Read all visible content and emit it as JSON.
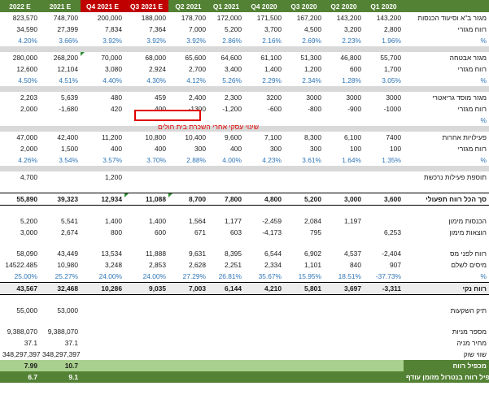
{
  "headers": [
    "2022 E",
    "2021 E",
    "Q4 2021 E",
    "Q3 2021 E",
    "Q2 2021",
    "Q1 2021",
    "Q4 2020",
    "Q3 2020",
    "Q2 2020",
    "Q1 2020",
    ""
  ],
  "rows": {
    "r1": [
      "823,570",
      "748,700",
      "200,000",
      "188,000",
      "178,700",
      "172,000",
      "171,500",
      "167,200",
      "143,200",
      "143,200",
      "מגזר ב\"א וסיעוד הכנסות"
    ],
    "r2": [
      "34,590",
      "27,399",
      "7,834",
      "7,364",
      "7,000",
      "5,200",
      "3,700",
      "4,500",
      "3,200",
      "2,800",
      "רווח מגזרי"
    ],
    "r3": [
      "4.20%",
      "3.66%",
      "3.92%",
      "3.92%",
      "3.92%",
      "2.86%",
      "2.16%",
      "2.69%",
      "2.23%",
      "1.96%",
      "%"
    ],
    "r4": [
      "280,000",
      "268,200",
      "70,000",
      "68,000",
      "65,600",
      "64,600",
      "61,100",
      "51,300",
      "46,800",
      "55,700",
      "מגזר אבטחה"
    ],
    "r5": [
      "12,600",
      "12,104",
      "3,080",
      "2,924",
      "2,700",
      "3,400",
      "1,400",
      "1,200",
      "600",
      "1,700",
      "רווח מגזרי"
    ],
    "r6": [
      "4.50%",
      "4.51%",
      "4.40%",
      "4.30%",
      "4.12%",
      "5.26%",
      "2.29%",
      "2.34%",
      "1.28%",
      "3.05%",
      "%"
    ],
    "r7": [
      "2,203",
      "5,639",
      "480",
      "459",
      "2,400",
      "2,300",
      "3200",
      "3000",
      "3000",
      "3000",
      "מגזר מוסד גריאטרי"
    ],
    "r8": [
      "2,000",
      "-1,680",
      "420",
      "400",
      "-1300",
      "-1,200",
      "-600",
      "-800",
      "-900",
      "-1000",
      "רווח מגזרי"
    ],
    "r9": [
      "",
      "",
      "",
      "",
      "",
      "",
      "",
      "",
      "",
      "",
      "%"
    ],
    "r10": [
      "47,000",
      "42,400",
      "11,200",
      "10,800",
      "10,400",
      "9,600",
      "7,100",
      "8,300",
      "6,100",
      "7400",
      "פעילויות אחרות"
    ],
    "r11": [
      "2,000",
      "1,500",
      "400",
      "400",
      "300",
      "400",
      "300",
      "300",
      "100",
      "100",
      "רווח מגזרי"
    ],
    "r12": [
      "4.26%",
      "3.54%",
      "3.57%",
      "3.70%",
      "2.88%",
      "4.00%",
      "4.23%",
      "3.61%",
      "1.64%",
      "1.35%",
      "%"
    ],
    "r13": [
      "4,700",
      "",
      "1,200",
      "",
      "",
      "",
      "",
      "",
      "",
      "",
      "תוספת פעילות נרכשת"
    ],
    "r14": [
      "55,890",
      "39,323",
      "12,934",
      "11,088",
      "8,700",
      "7,800",
      "4,800",
      "5,200",
      "3,000",
      "3,600",
      "סך הכל רווח תפעולי"
    ],
    "r15": [
      "5,200",
      "5,541",
      "1,400",
      "1,400",
      "1,564",
      "1,177",
      "-2,459",
      "2,084",
      "1,197",
      "",
      "הכנסות מימון"
    ],
    "r16": [
      "3,000",
      "2,674",
      "800",
      "600",
      "671",
      "603",
      "-4,173",
      "795",
      "",
      "6,253",
      "הוצאות מימון"
    ],
    "r17": [
      "58,090",
      "43,449",
      "13,534",
      "11,888",
      "9,631",
      "8,395",
      "6,544",
      "6,902",
      "4,537",
      "-2,404",
      "רווח לפני מס"
    ],
    "r18": [
      "14522.485",
      "10,980",
      "3,248",
      "2,853",
      "2,628",
      "2,251",
      "2,334",
      "1,101",
      "840",
      "907",
      "מיסים לשלם"
    ],
    "r19": [
      "25.00%",
      "25.27%",
      "24.00%",
      "24.00%",
      "27.29%",
      "26.81%",
      "35.67%",
      "15.95%",
      "18.51%",
      "-37.73%",
      "%"
    ],
    "r20": [
      "43,567",
      "32,468",
      "10,286",
      "9,035",
      "7,003",
      "6,144",
      "4,210",
      "5,801",
      "3,697",
      "-3,311",
      "רווח נקי"
    ],
    "r21": [
      "55,000",
      "53,000",
      "",
      "",
      "",
      "",
      "",
      "",
      "",
      "",
      "תיק השקעות"
    ],
    "r22": [
      "9,388,070",
      "9,388,070",
      "",
      "",
      "",
      "",
      "",
      "",
      "",
      "",
      "מספר מניות"
    ],
    "r23": [
      "37.1",
      "37.1",
      "",
      "",
      "",
      "",
      "",
      "",
      "",
      "",
      "מחיר מניה"
    ],
    "r24": [
      "348,297,397",
      "348,297,397",
      "",
      "",
      "",
      "",
      "",
      "",
      "",
      "",
      "שווי שוק"
    ],
    "r25": [
      "7.99",
      "10.7",
      "",
      "",
      "",
      "",
      "",
      "",
      "",
      "",
      "מכפיל רווח"
    ],
    "r26": [
      "6.7",
      "9.1",
      "",
      "",
      "",
      "",
      "",
      "",
      "",
      "",
      "מכפיל רווח בנטרול מזומן עודף"
    ]
  },
  "highlight_note": "שינוי עסקי אחרי השכרת בית חולים",
  "colors": {
    "header_green": "#548235",
    "header_red": "#c00000",
    "percent_blue": "#2e75b6",
    "highlight_red": "#e00000",
    "light_green": "#a9d08e"
  }
}
